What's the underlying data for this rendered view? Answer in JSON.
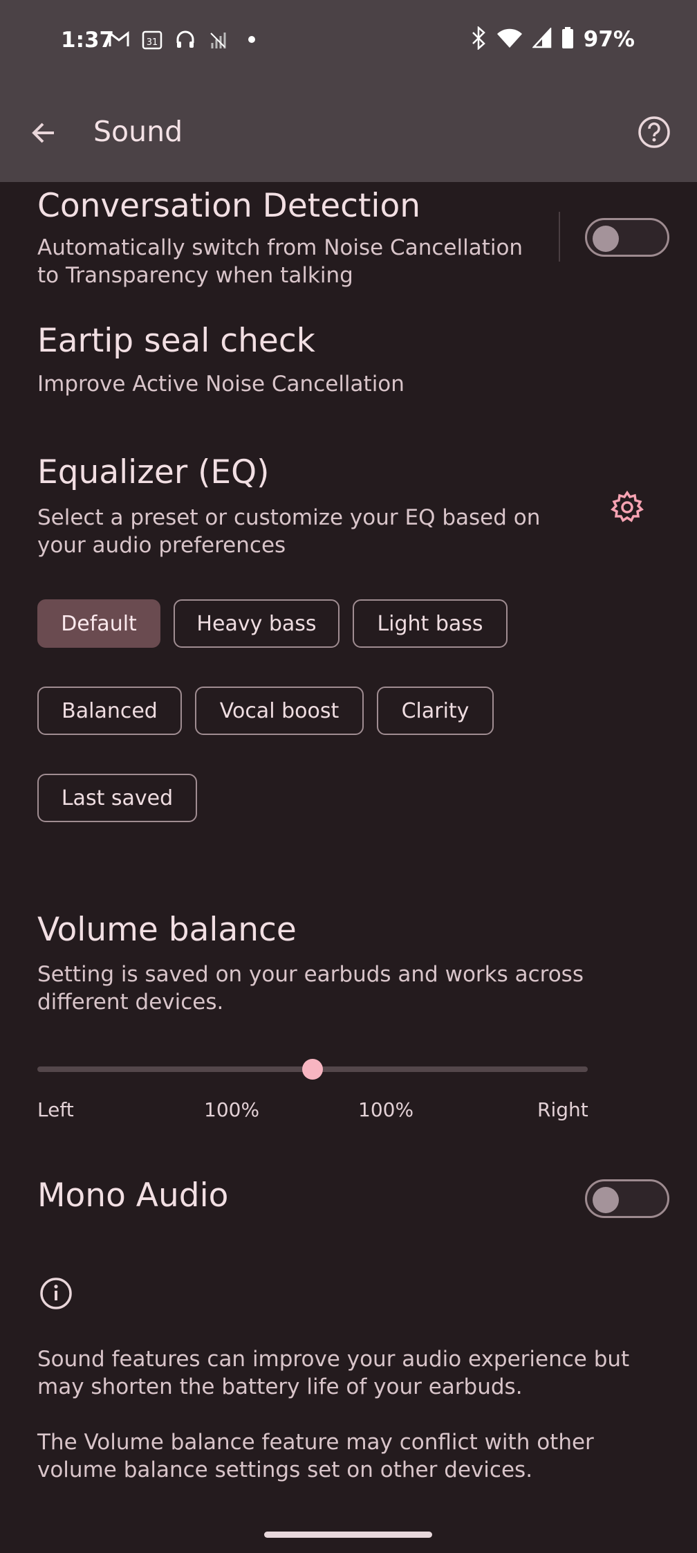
{
  "status_bar": {
    "time": "1:37",
    "battery": "97%",
    "icons_left": [
      "gmail-icon",
      "calendar-icon",
      "headphones-icon",
      "signal-off-icon",
      "dot-icon"
    ],
    "icons_right": [
      "bluetooth-icon",
      "wifi-icon",
      "cell-signal-icon",
      "battery-icon"
    ]
  },
  "app_bar": {
    "title": "Sound",
    "back_icon": "arrow-back-icon",
    "help_icon": "help-icon"
  },
  "conversation_detection": {
    "title": "Conversation Detection",
    "description_line1": "Automatically switch from Noise Cancellation",
    "description_line2": "to Transparency when talking",
    "enabled": false
  },
  "eartip_seal": {
    "title": "Eartip seal check",
    "description": "Improve Active Noise Cancellation"
  },
  "equalizer": {
    "title": "Equalizer (EQ)",
    "description_line1": "Select a preset or customize your EQ based on",
    "description_line2": "your audio preferences",
    "settings_icon": "gear-icon",
    "presets": [
      "Default",
      "Heavy bass",
      "Light bass",
      "Balanced",
      "Vocal boost",
      "Clarity",
      "Last saved"
    ],
    "selected": "Default"
  },
  "volume_balance": {
    "title": "Volume balance",
    "description_line1": "Setting is saved on your earbuds and works across",
    "description_line2": "different devices.",
    "left_label": "Left",
    "right_label": "Right",
    "left_value": "100%",
    "right_value": "100%",
    "position": 0.5
  },
  "mono_audio": {
    "title": "Mono Audio",
    "enabled": false
  },
  "info": {
    "icon": "info-icon",
    "note1_line1": "Sound features can improve your audio experience but",
    "note1_line2": "may shorten the battery life of your earbuds.",
    "note2_line1": "The Volume balance feature may conflict with other",
    "note2_line2": "volume balance settings set on other devices."
  },
  "colors": {
    "background": "#241b1e",
    "app_bar": "#4b4246",
    "accent": "#f7b5c1",
    "selected_chip": "#6a4b50"
  }
}
